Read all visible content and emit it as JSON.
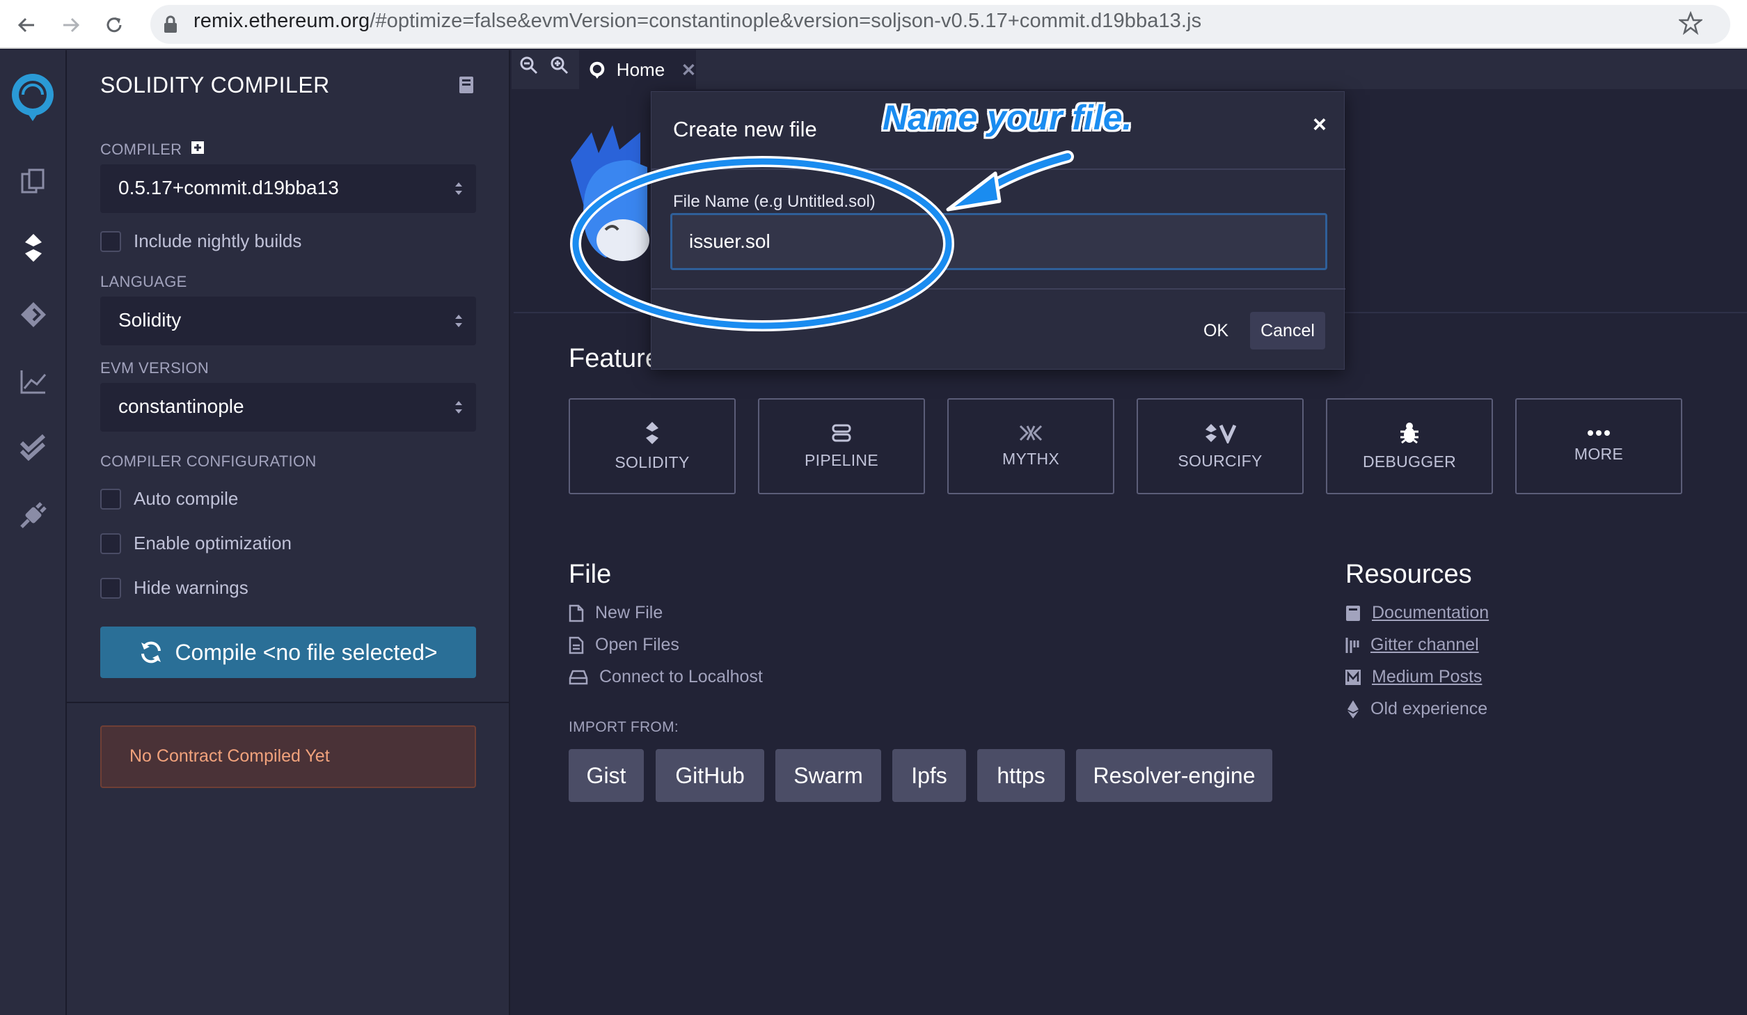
{
  "browser": {
    "url_host": "remix.ethereum.org",
    "url_rest": "/#optimize=false&evmVersion=constantinople&version=soljson-v0.5.17+commit.d19bba13.js"
  },
  "panel": {
    "title": "SOLIDITY COMPILER",
    "compiler_label": "COMPILER",
    "compiler_value": "0.5.17+commit.d19bba13",
    "nightly_label": "Include nightly builds",
    "language_label": "LANGUAGE",
    "language_value": "Solidity",
    "evm_label": "EVM VERSION",
    "evm_value": "constantinople",
    "config_label": "COMPILER CONFIGURATION",
    "auto_compile": "Auto compile",
    "enable_optimization": "Enable optimization",
    "hide_warnings": "Hide warnings",
    "compile_button": "Compile <no file selected>",
    "no_contract": "No Contract Compiled Yet"
  },
  "tabs": {
    "home": "Home"
  },
  "home": {
    "featured_heading": "Feature",
    "featured": [
      "SOLIDITY",
      "PIPELINE",
      "MYTHX",
      "SOURCIFY",
      "DEBUGGER",
      "MORE"
    ],
    "file_heading": "File",
    "file_links": [
      "New File",
      "Open Files",
      "Connect to Localhost"
    ],
    "resources_heading": "Resources",
    "resource_links": [
      "Documentation",
      "Gitter channel",
      "Medium Posts",
      "Old experience"
    ],
    "import_label": "IMPORT FROM:",
    "import_buttons": [
      "Gist",
      "GitHub",
      "Swarm",
      "Ipfs",
      "https",
      "Resolver-engine"
    ]
  },
  "modal": {
    "title": "Create new file",
    "close": "×",
    "field_label": "File Name (e.g Untitled.sol)",
    "field_value": "issuer.sol",
    "ok": "OK",
    "cancel": "Cancel"
  },
  "annotation": {
    "text": "Name your file."
  },
  "colors": {
    "accent": "#2a6f97",
    "annotation": "#1a8cf0",
    "warning_text": "#f1a27c"
  }
}
